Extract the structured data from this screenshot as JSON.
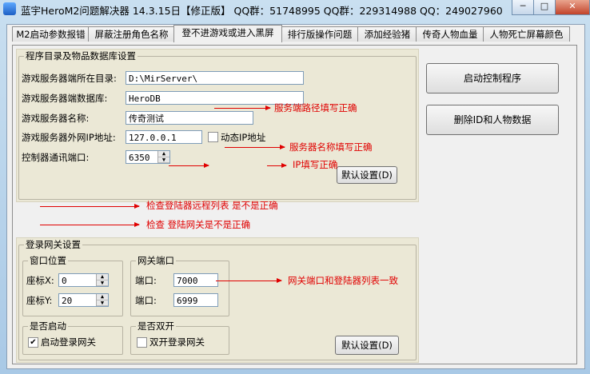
{
  "window": {
    "title": "蓝宇HeroM2问题解决器 14.3.15日【修正版】 QQ群：51748995 QQ群：229314988 QQ：249027960",
    "minimize": "─",
    "maximize": "□",
    "close": "✕"
  },
  "tabs": [
    {
      "label": "M2启动参数报错"
    },
    {
      "label": "屏蔽注册角色名称"
    },
    {
      "label": "登不进游戏或进入黑屏"
    },
    {
      "label": "排行版操作问题"
    },
    {
      "label": "添加经验猪"
    },
    {
      "label": "传奇人物血量"
    },
    {
      "label": "人物死亡屏幕颜色"
    }
  ],
  "server_section": {
    "title": "程序目录及物品数据库设置",
    "dir_label": "游戏服务器端所在目录:",
    "dir_value": "D:\\MirServer\\",
    "db_label": "游戏服务器端数据库:",
    "db_value": "HeroDB",
    "name_label": "游戏服务器名称:",
    "name_value": "传奇测试",
    "ip_label": "游戏服务器外网IP地址:",
    "ip_value": "127.0.0.1",
    "dynamic_ip_label": "动态IP地址",
    "port_label": "控制器通讯端口:",
    "port_value": "6350",
    "default_button": "默认设置(D)"
  },
  "notes": {
    "dir_note": "服务端路径填写正确",
    "name_note": "服务器名称填写正确",
    "ip_note": "IP填写正确",
    "list_note": "检查登陆器远程列表 是不是正确",
    "gateway_note": "检查 登陆网关是不是正确",
    "port_note": "网关端口和登陆器列表一致"
  },
  "login_gateway": {
    "title": "登录网关设置",
    "window_pos": {
      "title": "窗口位置",
      "x_label": "座标X:",
      "x_value": "0",
      "y_label": "座标Y:",
      "y_value": "20"
    },
    "gateway_port": {
      "title": "网关端口",
      "port1_label": "端口:",
      "port1_value": "7000",
      "port2_label": "端口:",
      "port2_value": "6999"
    },
    "startup": {
      "title": "是否启动",
      "checkbox_label": "启动登录网关",
      "checked": "✔"
    },
    "dual": {
      "title": "是否双开",
      "checkbox_label": "双开登录网关"
    },
    "default_button": "默认设置(D)"
  },
  "actions": {
    "start_button": "启动控制程序",
    "delete_button": "删除ID和人物数据"
  }
}
